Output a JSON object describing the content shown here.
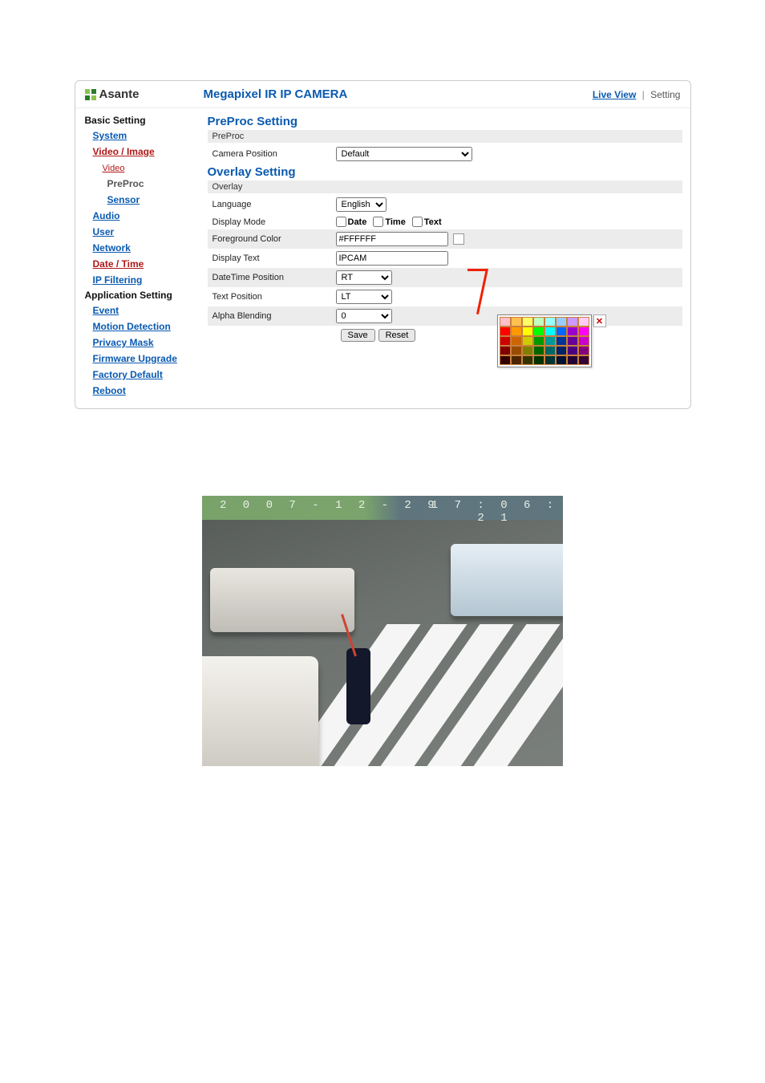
{
  "header": {
    "brand": "Asante",
    "title": "Megapixel IR IP CAMERA",
    "links": {
      "live_view": "Live View",
      "setting": "Setting"
    }
  },
  "sidebar": {
    "basic_title": "Basic Setting",
    "basic": {
      "system": "System",
      "video_image": "Video / Image",
      "video": "Video",
      "preproc": "PreProc",
      "sensor": "Sensor",
      "audio": "Audio",
      "user": "User",
      "network": "Network",
      "date_time": "Date / Time",
      "ip_filtering": "IP Filtering"
    },
    "app_title": "Application Setting",
    "app": {
      "event": "Event",
      "motion": "Motion Detection",
      "privacy": "Privacy Mask",
      "firmware": "Firmware Upgrade",
      "factory": "Factory Default",
      "reboot": "Reboot"
    }
  },
  "sections": {
    "preproc_title": "PreProc Setting",
    "preproc_bar": "PreProc",
    "camera_position_label": "Camera Position",
    "camera_position_value": "Default",
    "overlay_title": "Overlay Setting",
    "overlay_bar": "Overlay",
    "language_label": "Language",
    "language_value": "English",
    "display_mode_label": "Display Mode",
    "display_mode": {
      "date": "Date",
      "time": "Time",
      "text": "Text"
    },
    "fg_color_label": "Foreground Color",
    "fg_color_value": "#FFFFFF",
    "display_text_label": "Display Text",
    "display_text_value": "IPCAM",
    "dt_pos_label": "DateTime Position",
    "dt_pos_value": "RT",
    "text_pos_label": "Text Position",
    "text_pos_value": "LT",
    "alpha_label": "Alpha Blending",
    "alpha_value": "0",
    "save": "Save",
    "reset": "Reset"
  },
  "preview": {
    "date": "2 0 0 7 - 1 2 - 2 9",
    "time": "1 7 : 0 6 : 2 1"
  },
  "colorpicker": {
    "rows": [
      [
        "#ffc0cb",
        "#ffc04e",
        "#ffff66",
        "#c0ffc0",
        "#99ffff",
        "#99ccff",
        "#cc99ff",
        "#ffccff"
      ],
      [
        "#ff0000",
        "#ff9900",
        "#ffff00",
        "#00ff00",
        "#00ffff",
        "#0066ff",
        "#9900cc",
        "#ff00ff"
      ],
      [
        "#cc0000",
        "#cc6600",
        "#cccc00",
        "#009900",
        "#009999",
        "#003399",
        "#660099",
        "#cc00cc"
      ],
      [
        "#800000",
        "#994c00",
        "#808000",
        "#006600",
        "#006666",
        "#002266",
        "#4b0082",
        "#800080"
      ],
      [
        "#330000",
        "#4d2600",
        "#333300",
        "#003300",
        "#003333",
        "#001133",
        "#220033",
        "#330033"
      ]
    ]
  }
}
